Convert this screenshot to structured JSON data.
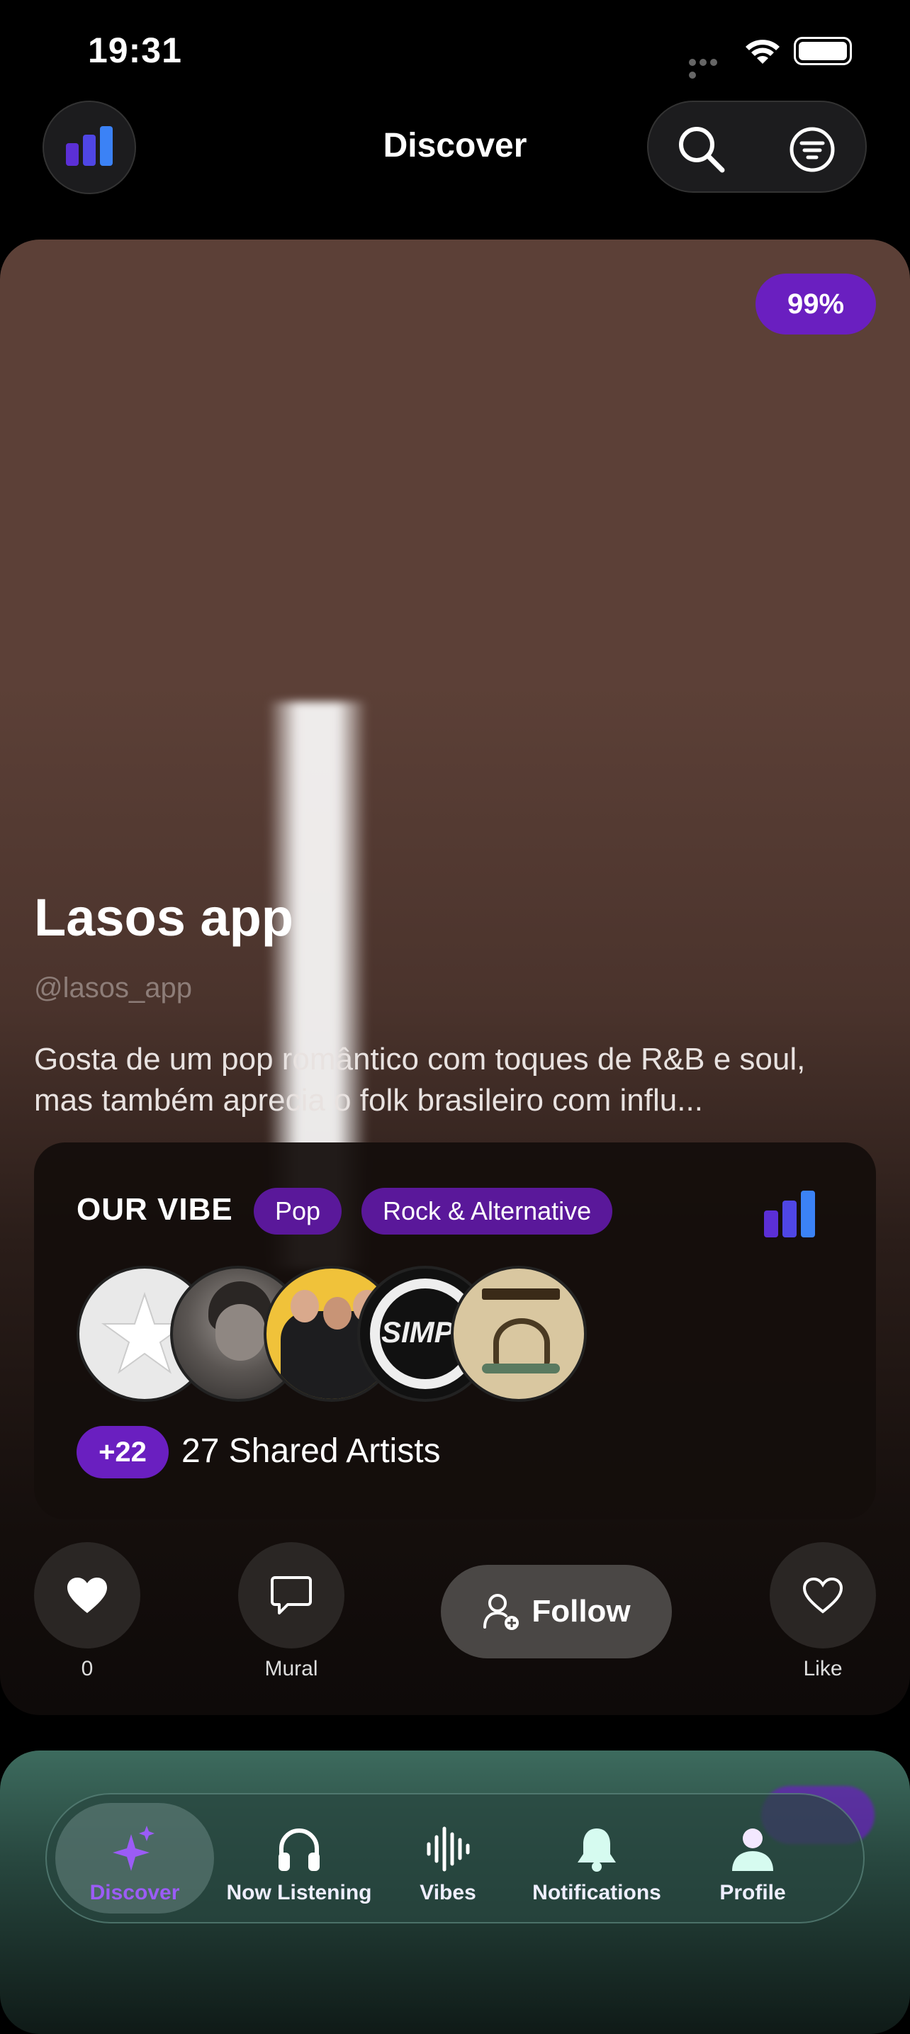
{
  "status_bar": {
    "time": "19:31"
  },
  "header": {
    "title": "Discover",
    "logo_icon": "app-logo-bars-icon",
    "search_icon": "search-icon",
    "filter_icon": "filter-icon"
  },
  "colors": {
    "accent": "#6a1fc0",
    "tag_bg": "#5a189a",
    "card_bg": "#5c4037",
    "bar_dark": "#5b2fd6",
    "bar_light": "#3b82f6"
  },
  "profile": {
    "match": "99%",
    "name": "Lasos app",
    "handle": "@lasos_app",
    "bio": "Gosta de um pop romântico com toques de R&B e soul, mas também aprecia o folk brasileiro com influ..."
  },
  "vibe": {
    "title": "OUR VIBE",
    "tags": [
      "Pop",
      "Rock & Alternative"
    ],
    "extra_count": "+22",
    "shared_label": "27 Shared Artists"
  },
  "actions": {
    "likes_count": "0",
    "mural_label": "Mural",
    "follow_label": "Follow",
    "like_label": "Like"
  },
  "tabs": [
    {
      "label": "Discover",
      "icon": "sparkles-icon",
      "active": true
    },
    {
      "label": "Now Listening",
      "icon": "headphones-icon"
    },
    {
      "label": "Vibes",
      "icon": "waveform-icon"
    },
    {
      "label": "Notifications",
      "icon": "bell-icon"
    },
    {
      "label": "Profile",
      "icon": "person-icon"
    }
  ]
}
